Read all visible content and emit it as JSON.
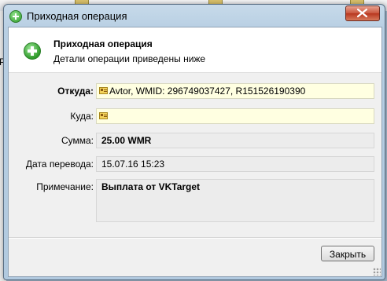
{
  "background": {
    "left_char": "P"
  },
  "window": {
    "title": "Приходная операция"
  },
  "header": {
    "title": "Приходная операция",
    "subtitle": "Детали операции приведены ниже"
  },
  "fields": {
    "from_label": "Откуда:",
    "from_value": "Avtor, WMID: 296749037427, R151526190390",
    "to_label": "Куда:",
    "to_value": "",
    "amount_label": "Сумма:",
    "amount_value": "25.00 WMR",
    "date_label": "Дата перевода:",
    "date_value": "15.07.16 15:23",
    "note_label": "Примечание:",
    "note_value": "Выплата от VKTarget"
  },
  "footer": {
    "close_label": "Закрыть"
  }
}
